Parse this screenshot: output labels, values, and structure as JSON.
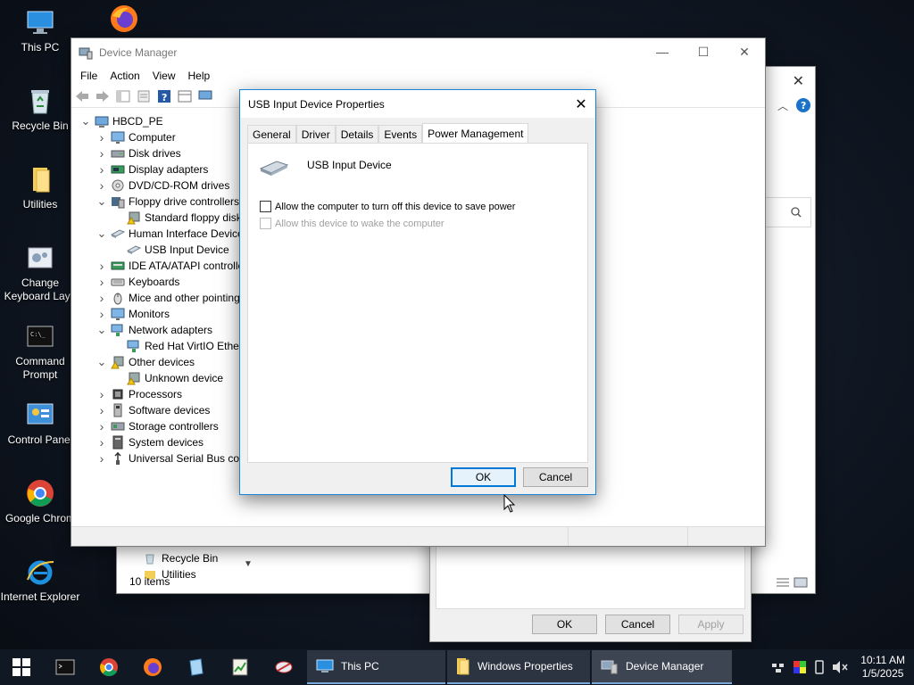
{
  "desktop": {
    "icons": [
      {
        "name": "this-pc",
        "label": "This PC"
      },
      {
        "name": "firefox",
        "label": ""
      },
      {
        "name": "recycle-bin",
        "label": "Recycle Bin"
      },
      {
        "name": "utilities",
        "label": "Utilities"
      },
      {
        "name": "change-keyboard-layout",
        "label": "Change Keyboard Layo"
      },
      {
        "name": "command-prompt",
        "label": "Command Prompt"
      },
      {
        "name": "control-panel",
        "label": "Control Panel"
      },
      {
        "name": "google-chrome",
        "label": "Google Chrom"
      },
      {
        "name": "internet-explorer",
        "label": "Internet Explorer"
      }
    ]
  },
  "explorer_back": {
    "nav_items": [
      "Recycle Bin",
      "Utilities"
    ],
    "status": "10 items"
  },
  "win_props": {
    "ok": "OK",
    "cancel": "Cancel",
    "apply": "Apply"
  },
  "devmgr": {
    "title": "Device Manager",
    "menu": [
      "File",
      "Action",
      "View",
      "Help"
    ],
    "tree": [
      {
        "level": 0,
        "expander": "open",
        "label": "HBCD_PE",
        "icon": "computer-root-icon"
      },
      {
        "level": 1,
        "expander": "closed",
        "label": "Computer",
        "icon": "monitor-icon"
      },
      {
        "level": 1,
        "expander": "closed",
        "label": "Disk drives",
        "icon": "disk-drive-icon"
      },
      {
        "level": 1,
        "expander": "closed",
        "label": "Display adapters",
        "icon": "display-adapter-icon"
      },
      {
        "level": 1,
        "expander": "closed",
        "label": "DVD/CD-ROM drives",
        "icon": "dvd-icon"
      },
      {
        "level": 1,
        "expander": "open",
        "label": "Floppy drive controllers",
        "icon": "floppy-controller-icon"
      },
      {
        "level": 2,
        "expander": "none",
        "label": "Standard floppy disk",
        "icon": "warning-device-icon"
      },
      {
        "level": 1,
        "expander": "open",
        "label": "Human Interface Devices",
        "icon": "hid-icon"
      },
      {
        "level": 2,
        "expander": "none",
        "label": "USB Input Device",
        "icon": "hid-icon"
      },
      {
        "level": 1,
        "expander": "closed",
        "label": "IDE ATA/ATAPI controllers",
        "icon": "ide-icon"
      },
      {
        "level": 1,
        "expander": "closed",
        "label": "Keyboards",
        "icon": "keyboard-icon"
      },
      {
        "level": 1,
        "expander": "closed",
        "label": "Mice and other pointing",
        "icon": "mouse-icon"
      },
      {
        "level": 1,
        "expander": "closed",
        "label": "Monitors",
        "icon": "monitor-icon"
      },
      {
        "level": 1,
        "expander": "open",
        "label": "Network adapters",
        "icon": "network-icon"
      },
      {
        "level": 2,
        "expander": "none",
        "label": "Red Hat VirtIO Ethernet",
        "icon": "network-icon"
      },
      {
        "level": 1,
        "expander": "open",
        "label": "Other devices",
        "icon": "other-devices-icon"
      },
      {
        "level": 2,
        "expander": "none",
        "label": "Unknown device",
        "icon": "warning-device-icon"
      },
      {
        "level": 1,
        "expander": "closed",
        "label": "Processors",
        "icon": "processor-icon"
      },
      {
        "level": 1,
        "expander": "closed",
        "label": "Software devices",
        "icon": "software-device-icon"
      },
      {
        "level": 1,
        "expander": "closed",
        "label": "Storage controllers",
        "icon": "storage-icon"
      },
      {
        "level": 1,
        "expander": "closed",
        "label": "System devices",
        "icon": "system-device-icon"
      },
      {
        "level": 1,
        "expander": "closed",
        "label": "Universal Serial Bus controllers",
        "icon": "usb-icon"
      }
    ]
  },
  "usb_dialog": {
    "title": "USB Input Device Properties",
    "tabs": [
      "General",
      "Driver",
      "Details",
      "Events",
      "Power Management"
    ],
    "active_tab": "Power Management",
    "device_name": "USB Input Device",
    "options": [
      {
        "label": "Allow the computer to turn off this device to save power",
        "checked": false,
        "enabled": true
      },
      {
        "label": "Allow this device to wake the computer",
        "checked": false,
        "enabled": false
      }
    ],
    "ok": "OK",
    "cancel": "Cancel"
  },
  "taskbar": {
    "windows": [
      {
        "label": "This PC",
        "icon": "this-pc-icon"
      },
      {
        "label": "Windows Properties",
        "icon": "folder-icon"
      },
      {
        "label": "Device Manager",
        "icon": "device-manager-icon"
      }
    ],
    "time": "10:11 AM",
    "date": "1/5/2025"
  },
  "colors": {
    "accent": "#0078d7",
    "taskbar": "#101823"
  }
}
